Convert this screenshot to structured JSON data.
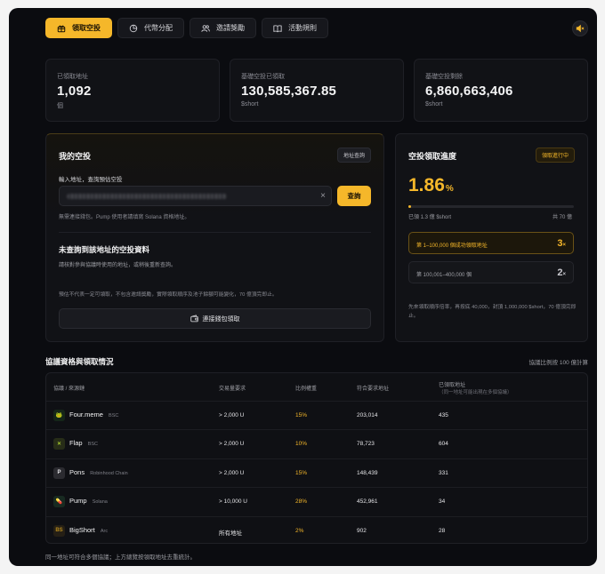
{
  "nav": {
    "tabs": [
      {
        "label": "領取空投",
        "icon": "gift-icon",
        "active": true
      },
      {
        "label": "代幣分配",
        "icon": "pie-icon",
        "active": false
      },
      {
        "label": "邀請獎勵",
        "icon": "users-icon",
        "active": false
      },
      {
        "label": "活動規則",
        "icon": "book-icon",
        "active": false
      }
    ],
    "mute_icon": "speaker-mute-icon"
  },
  "stats": [
    {
      "label": "已領取地址",
      "value": "1,092",
      "unit": "個"
    },
    {
      "label": "基礎空投已領取",
      "value": "130,585,367.85",
      "unit": "$short"
    },
    {
      "label": "基礎空投剩餘",
      "value": "6,860,663,406",
      "unit": "$short"
    }
  ],
  "my_airdrop": {
    "title": "我的空投",
    "lookup_badge": "地址查詢",
    "input_label": "輸入地址，查詢預估空投",
    "query_button": "查詢",
    "hint": "無需連接錢包。Pump 使用者請填寫 Solana 資格地址。",
    "empty_title": "未查詢到該地址的空投資料",
    "empty_desc": "請核對參與協議時使用的地址，或稍後重新查詢。",
    "disclaimer": "預估不代表一定可領取，不包含邀請獎勵，實際領取順序及池子餘額可能變化，70 億頂完即止。",
    "connect_button": "連接錢包領取"
  },
  "progress": {
    "title": "空投領取進度",
    "status_badge": "領取進行中",
    "percent": "1.86",
    "percent_unit": "%",
    "fill_fraction": 0.0186,
    "claimed_text": "已領 1.3 億 $short",
    "total_text": "共 70 億",
    "tiers": [
      {
        "label": "第 1–100,000 個成功領取地址",
        "multiplier": "3",
        "active": true
      },
      {
        "label": "第 100,001–400,000 個",
        "multiplier": "2",
        "active": false
      }
    ],
    "mult_suffix": "×",
    "note": "先來領取順序倍率，再按底 40,000，封頂 1,000,000 $short，70 億頂完即止。"
  },
  "table": {
    "title": "協議資格與領取情況",
    "note": "協議比例按 100 億計算",
    "headers": {
      "source": "協議 / 來源鏈",
      "volume": "交易量要求",
      "weight": "比例權重",
      "eligible": "符合要求地址",
      "claimed": "已領取地址",
      "claimed_sub": "（同一地址可能出現在多個協議）"
    },
    "rows": [
      {
        "name": "Four.meme",
        "chain": "BSC",
        "volume": "> 2,000 U",
        "weight": "15%",
        "eligible": "203,014",
        "claimed": "435",
        "logo_color": "#3fbf3f",
        "logo_glyph": "🐸"
      },
      {
        "name": "Flap",
        "chain": "BSC",
        "volume": "> 2,000 U",
        "weight": "10%",
        "eligible": "78,723",
        "claimed": "604",
        "logo_color": "#c6f135",
        "logo_glyph": "✕"
      },
      {
        "name": "Pons",
        "chain": "Robinhood Chain",
        "volume": "> 2,000 U",
        "weight": "15%",
        "eligible": "148,439",
        "claimed": "331",
        "logo_color": "#e4e4e7",
        "logo_glyph": "P"
      },
      {
        "name": "Pump",
        "chain": "Solana",
        "volume": "> 10,000 U",
        "weight": "28%",
        "eligible": "452,961",
        "claimed": "34",
        "logo_color": "#54d67a",
        "logo_glyph": "💊"
      },
      {
        "name": "BigShort",
        "chain": "Arc",
        "volume": "所有地址",
        "weight": "2%",
        "eligible": "902",
        "claimed": "28",
        "logo_color": "#b58a1e",
        "logo_glyph": "BS"
      }
    ]
  },
  "footer_note": "同一地址可符合多個協議；上方總覽按領取地址去重統計。",
  "colors": {
    "accent": "#f5b72a",
    "bg": "#0b0c10"
  }
}
